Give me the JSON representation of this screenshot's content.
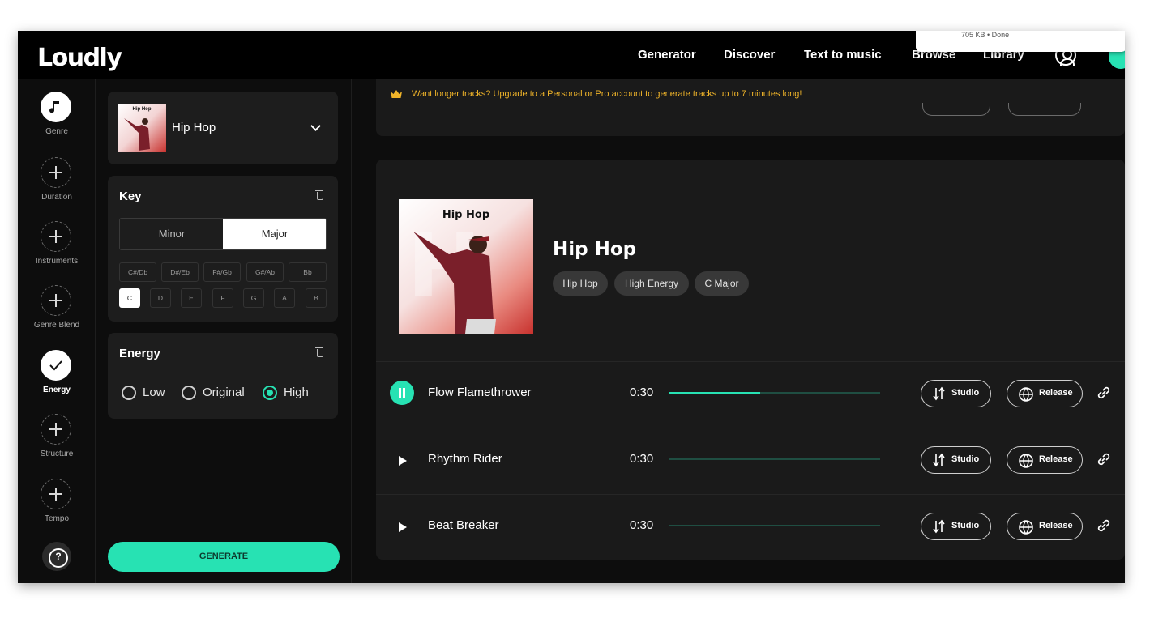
{
  "brand": {
    "logo": "Loudly",
    "accent": "#27e2b3",
    "warning": "#f0b429"
  },
  "download_popup": {
    "text": "705 KB • Done"
  },
  "nav": {
    "links": [
      "Generator",
      "Discover",
      "Text to music",
      "Browse",
      "Library"
    ],
    "user_icon": "user-circle-icon"
  },
  "rail": {
    "items": [
      {
        "label": "Genre",
        "icon": "music-note-icon",
        "state": "set"
      },
      {
        "label": "Duration",
        "icon": "plus-icon",
        "state": "empty"
      },
      {
        "label": "Instruments",
        "icon": "plus-icon",
        "state": "empty"
      },
      {
        "label": "Genre Blend",
        "icon": "plus-icon",
        "state": "empty"
      },
      {
        "label": "Energy",
        "icon": "check-icon",
        "state": "active"
      },
      {
        "label": "Structure",
        "icon": "plus-icon",
        "state": "empty"
      },
      {
        "label": "Tempo",
        "icon": "plus-icon",
        "state": "empty"
      }
    ],
    "help_icon": "question-icon"
  },
  "settings": {
    "genre": {
      "name": "Hip Hop",
      "thumb_title": "Hip Hop"
    },
    "key": {
      "title": "Key",
      "modes": [
        "Minor",
        "Major"
      ],
      "selected_mode": "Major",
      "sharps": [
        "C#/Db",
        "D#/Eb",
        "F#/Gb",
        "G#/Ab",
        "Bb"
      ],
      "naturals": [
        "C",
        "D",
        "E",
        "F",
        "G",
        "A",
        "B"
      ],
      "selected_key": "C"
    },
    "energy": {
      "title": "Energy",
      "options": [
        "Low",
        "Original",
        "High"
      ],
      "selected": "High"
    },
    "generate_label": "GENERATE"
  },
  "main": {
    "upgrade_text": "Want longer tracks? Upgrade to a Personal or Pro account to generate tracks up to 7 minutes long!",
    "result": {
      "cover_title": "Hip Hop",
      "title": "Hip Hop",
      "tags": [
        "Hip Hop",
        "High Energy",
        "C Major"
      ],
      "tracks": [
        {
          "name": "Flow Flamethrower",
          "duration": "0:30",
          "playing": true,
          "progress": 0.43
        },
        {
          "name": "Rhythm Rider",
          "duration": "0:30",
          "playing": false,
          "progress": 0
        },
        {
          "name": "Beat Breaker",
          "duration": "0:30",
          "playing": false,
          "progress": 0
        }
      ],
      "studio_label": "Studio",
      "release_label": "Release"
    }
  }
}
